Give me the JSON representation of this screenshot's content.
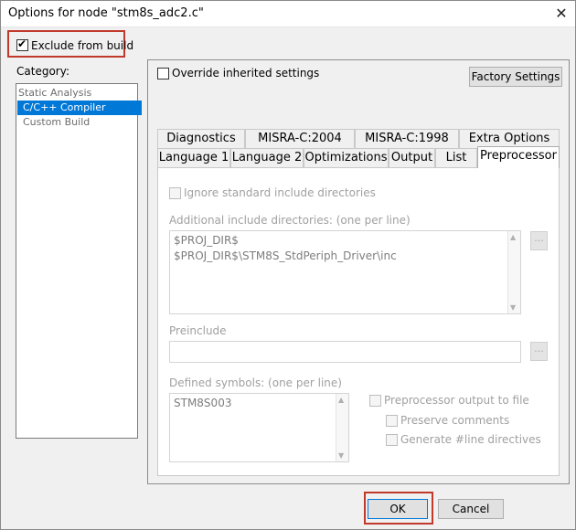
{
  "window": {
    "title": "Options for node \"stm8s_adc2.c\"",
    "close_glyph": "✕"
  },
  "exclude": {
    "label": "Exclude from build",
    "checked": true
  },
  "category": {
    "label": "Category:",
    "items": [
      "Static Analysis",
      "C/C++ Compiler",
      "Custom Build"
    ],
    "selected": "C/C++ Compiler"
  },
  "override": {
    "label": "Override inherited settings",
    "checked": false
  },
  "factory_label": "Factory Settings",
  "tabs_row1": [
    "Diagnostics",
    "MISRA-C:2004",
    "MISRA-C:1998",
    "Extra Options"
  ],
  "tabs_row2": [
    "Language 1",
    "Language 2",
    "Optimizations",
    "Output",
    "List",
    "Preprocessor"
  ],
  "active_tab": "Preprocessor",
  "preprocessor": {
    "ignore_std_label": "Ignore standard include directories",
    "ignore_std_checked": false,
    "additional_include_label": "Additional include directories: (one per line)",
    "include_dirs": [
      "$PROJ_DIR$",
      "$PROJ_DIR$\\STM8S_StdPeriph_Driver\\inc"
    ],
    "browse_label": "...",
    "preinclude_label": "Preinclude",
    "preinclude_value": "",
    "defined_symbols_label": "Defined symbols: (one per line)",
    "defined_symbols": [
      "STM8S003"
    ],
    "output_to_file_label": "Preprocessor output to file",
    "preserve_comments_label": "Preserve comments",
    "generate_line_label": "Generate #line directives"
  },
  "ok_label": "OK",
  "cancel_label": "Cancel",
  "colors": {
    "selection": "#0078d7",
    "highlight": "#c0392b",
    "focus": "#0078d7"
  }
}
